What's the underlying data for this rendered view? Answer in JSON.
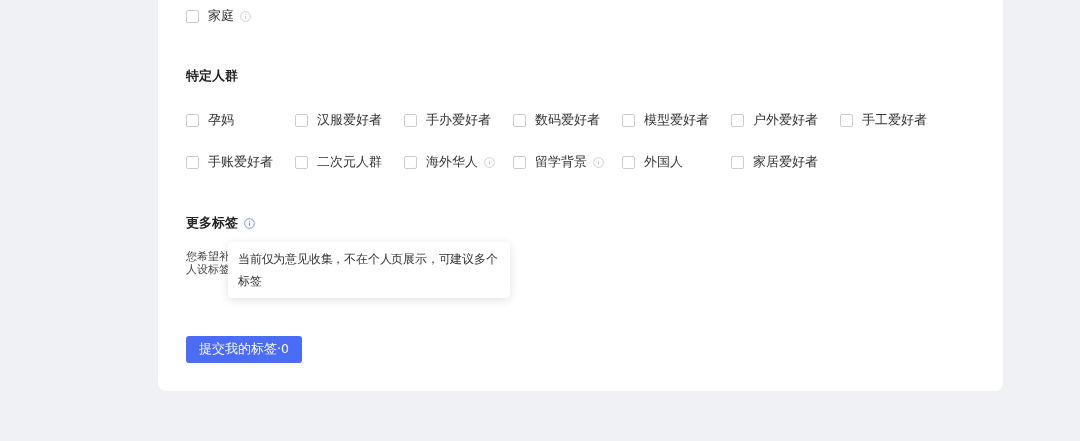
{
  "sections": [
    {
      "options": [
        {
          "label": "家庭",
          "checked": false,
          "info": true
        }
      ]
    },
    {
      "title": "特定人群",
      "options": [
        {
          "label": "孕妈",
          "checked": false,
          "info": false
        },
        {
          "label": "汉服爱好者",
          "checked": false,
          "info": false
        },
        {
          "label": "手办爱好者",
          "checked": false,
          "info": false
        },
        {
          "label": "数码爱好者",
          "checked": false,
          "info": false
        },
        {
          "label": "模型爱好者",
          "checked": false,
          "info": false
        },
        {
          "label": "户外爱好者",
          "checked": false,
          "info": false
        },
        {
          "label": "手工爱好者",
          "checked": false,
          "info": false
        },
        {
          "label": "手账爱好者",
          "checked": false,
          "info": false
        },
        {
          "label": "二次元人群",
          "checked": false,
          "info": false
        },
        {
          "label": "海外华人",
          "checked": false,
          "info": true
        },
        {
          "label": "留学背景",
          "checked": false,
          "info": true
        },
        {
          "label": "外国人",
          "checked": false,
          "info": false
        },
        {
          "label": "家居爱好者",
          "checked": false,
          "info": false
        }
      ]
    }
  ],
  "more_tags": {
    "title": "更多标签",
    "description_lines": [
      "您希望补",
      "人设标签"
    ],
    "tooltip": "当前仅为意见收集，不在个人页展示，可建议多个标签"
  },
  "submit_button": "提交我的标签·0"
}
